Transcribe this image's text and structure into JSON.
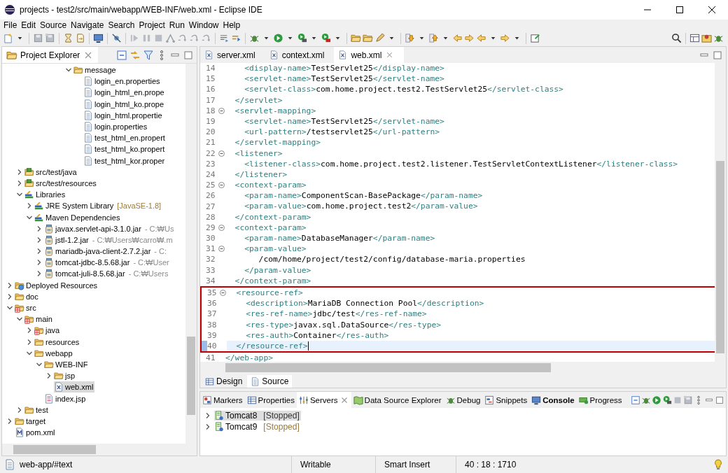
{
  "window": {
    "title": "projects - test2/src/main/webapp/WEB-INF/web.xml - Eclipse IDE"
  },
  "menu": [
    "File",
    "Edit",
    "Source",
    "Navigate",
    "Search",
    "Project",
    "Run",
    "Window",
    "Help"
  ],
  "project_explorer": {
    "title": "Project Explorer",
    "cut_branches": [
      [
        {
          "label": "message",
          "kind": "folder",
          "expanded": true,
          "selected": false,
          "children": [
            {
              "label": "login_en.properties",
              "kind": "file",
              "selected": false
            },
            {
              "label": "login_html_en.prope",
              "kind": "file",
              "selected": false
            },
            {
              "label": "login_html_ko.prope",
              "kind": "file",
              "selected": false
            },
            {
              "label": "login_html.propertie",
              "kind": "file",
              "selected": false
            },
            {
              "label": "login.properties",
              "kind": "file",
              "selected": false
            },
            {
              "label": "test_html_en.propert",
              "kind": "file",
              "selected": false
            },
            {
              "label": "test_html_ko.propert",
              "kind": "file",
              "selected": false
            },
            {
              "label": "test_html_kor.proper",
              "kind": "file",
              "selected": false
            }
          ]
        }
      ],
      [
        {
          "label": "src/test/java",
          "kind": "package",
          "expanded": false,
          "selected": false
        },
        {
          "label": "src/test/resources",
          "kind": "package",
          "expanded": false,
          "selected": false
        },
        {
          "label": "Libraries",
          "kind": "library",
          "expanded": true,
          "selected": false,
          "children": [
            {
              "label": "JRE System Library",
              "detail": "[JavaSE-1.8]",
              "kind": "library",
              "expanded": false,
              "selected": false
            },
            {
              "label": "Maven Dependencies",
              "kind": "library",
              "expanded": true,
              "selected": false,
              "children": [
                {
                  "label": "javax.servlet-api-3.1.0.jar",
                  "detail": "- C:₩Us",
                  "kind": "jar",
                  "expanded": false,
                  "selected": false
                },
                {
                  "label": "jstl-1.2.jar",
                  "detail": "- C:₩Users₩carro₩.m",
                  "kind": "jar",
                  "expanded": false,
                  "selected": false
                },
                {
                  "label": "mariadb-java-client-2.7.2.jar",
                  "detail": "- C:",
                  "kind": "jar",
                  "expanded": false,
                  "selected": false
                },
                {
                  "label": "tomcat-jdbc-8.5.68.jar",
                  "detail": "- C:₩User",
                  "kind": "jar",
                  "expanded": false,
                  "selected": false
                },
                {
                  "label": "tomcat-juli-8.5.68.jar",
                  "detail": "- C:₩Users",
                  "kind": "jar",
                  "expanded": false,
                  "selected": false
                }
              ]
            }
          ]
        }
      ]
    ],
    "items": [
      {
        "label": "Deployed Resources",
        "kind": "web",
        "expanded": false,
        "selected": false
      },
      {
        "label": "doc",
        "kind": "folder",
        "expanded": false,
        "selected": false
      },
      {
        "label": "src",
        "kind": "source",
        "expanded": true,
        "selected": false,
        "children": [
          {
            "label": "main",
            "kind": "source",
            "expanded": true,
            "selected": false,
            "children": [
              {
                "label": "java",
                "kind": "source",
                "expanded": false,
                "selected": false
              },
              {
                "label": "resources",
                "kind": "folder",
                "expanded": false,
                "selected": false
              },
              {
                "label": "webapp",
                "kind": "folder",
                "expanded": true,
                "selected": false,
                "children": [
                  {
                    "label": "WEB-INF",
                    "kind": "folder",
                    "expanded": true,
                    "selected": false,
                    "children": [
                      {
                        "label": "jsp",
                        "kind": "folder",
                        "expanded": false,
                        "selected": false
                      },
                      {
                        "label": "web.xml",
                        "kind": "xml",
                        "selected": true
                      }
                    ]
                  },
                  {
                    "label": "index.jsp",
                    "kind": "jsp",
                    "selected": false
                  }
                ]
              }
            ]
          },
          {
            "label": "test",
            "kind": "folder",
            "expanded": false,
            "selected": false
          }
        ]
      },
      {
        "label": "target",
        "kind": "folder",
        "expanded": false,
        "selected": false
      },
      {
        "label": "pom.xml",
        "kind": "maven",
        "selected": false
      }
    ]
  },
  "editor": {
    "tabs": [
      {
        "label": "server.xml",
        "selected": false
      },
      {
        "label": "context.xml",
        "selected": false
      },
      {
        "label": "web.xml",
        "selected": true
      }
    ],
    "lines": [
      {
        "number": "14",
        "fold": false,
        "boxed": false,
        "current": false,
        "tokens": [
          {
            "kind": "tag",
            "text": "    <display-name>"
          },
          {
            "kind": "text",
            "text": "TestServlet25"
          },
          {
            "kind": "tag",
            "text": "</display-name>"
          }
        ]
      },
      {
        "number": "15",
        "fold": false,
        "boxed": false,
        "current": false,
        "tokens": [
          {
            "kind": "tag",
            "text": "    <servlet-name>"
          },
          {
            "kind": "text",
            "text": "TestServlet25"
          },
          {
            "kind": "tag",
            "text": "</servlet-name>"
          }
        ]
      },
      {
        "number": "16",
        "fold": false,
        "boxed": false,
        "current": false,
        "tokens": [
          {
            "kind": "tag",
            "text": "    <servlet-class>"
          },
          {
            "kind": "text",
            "text": "com.home.project.test2.TestServlet25"
          },
          {
            "kind": "tag",
            "text": "</servlet-class>"
          }
        ]
      },
      {
        "number": "17",
        "fold": false,
        "boxed": false,
        "current": false,
        "tokens": [
          {
            "kind": "tag",
            "text": "  </servlet>"
          }
        ]
      },
      {
        "number": "18",
        "fold": true,
        "boxed": false,
        "current": false,
        "tokens": [
          {
            "kind": "tag",
            "text": "  <servlet-mapping>"
          }
        ]
      },
      {
        "number": "19",
        "fold": false,
        "boxed": false,
        "current": false,
        "tokens": [
          {
            "kind": "tag",
            "text": "    <servlet-name>"
          },
          {
            "kind": "text",
            "text": "TestServlet25"
          },
          {
            "kind": "tag",
            "text": "</servlet-name>"
          }
        ]
      },
      {
        "number": "20",
        "fold": false,
        "boxed": false,
        "current": false,
        "tokens": [
          {
            "kind": "tag",
            "text": "    <url-pattern>"
          },
          {
            "kind": "text",
            "text": "/testservlet25"
          },
          {
            "kind": "tag",
            "text": "</url-pattern>"
          }
        ]
      },
      {
        "number": "21",
        "fold": false,
        "boxed": false,
        "current": false,
        "tokens": [
          {
            "kind": "tag",
            "text": "  </servlet-mapping>"
          }
        ]
      },
      {
        "number": "22",
        "fold": true,
        "boxed": false,
        "current": false,
        "tokens": [
          {
            "kind": "tag",
            "text": "  <listener>"
          }
        ]
      },
      {
        "number": "23",
        "fold": false,
        "boxed": false,
        "current": false,
        "tokens": [
          {
            "kind": "tag",
            "text": "    <listener-class>"
          },
          {
            "kind": "text",
            "text": "com.home.project.test2.listener.TestServletContextListener"
          },
          {
            "kind": "tag",
            "text": "</listener-class>"
          }
        ]
      },
      {
        "number": "24",
        "fold": false,
        "boxed": false,
        "current": false,
        "tokens": [
          {
            "kind": "tag",
            "text": "  </listener>"
          }
        ]
      },
      {
        "number": "25",
        "fold": true,
        "boxed": false,
        "current": false,
        "tokens": [
          {
            "kind": "tag",
            "text": "  <context-param>"
          }
        ]
      },
      {
        "number": "26",
        "fold": false,
        "boxed": false,
        "current": false,
        "tokens": [
          {
            "kind": "tag",
            "text": "    <param-name>"
          },
          {
            "kind": "text",
            "text": "ComponentScan-BasePackage"
          },
          {
            "kind": "tag",
            "text": "</param-name>"
          }
        ]
      },
      {
        "number": "27",
        "fold": false,
        "boxed": false,
        "current": false,
        "tokens": [
          {
            "kind": "tag",
            "text": "    <param-value>"
          },
          {
            "kind": "text",
            "text": "com.home.project.test2"
          },
          {
            "kind": "tag",
            "text": "</param-value>"
          }
        ]
      },
      {
        "number": "28",
        "fold": false,
        "boxed": false,
        "current": false,
        "tokens": [
          {
            "kind": "tag",
            "text": "  </context-param>"
          }
        ]
      },
      {
        "number": "29",
        "fold": true,
        "boxed": false,
        "current": false,
        "tokens": [
          {
            "kind": "tag",
            "text": "  <context-param>"
          }
        ]
      },
      {
        "number": "30",
        "fold": false,
        "boxed": false,
        "current": false,
        "tokens": [
          {
            "kind": "tag",
            "text": "    <param-name>"
          },
          {
            "kind": "text",
            "text": "DatabaseManager"
          },
          {
            "kind": "tag",
            "text": "</param-name>"
          }
        ]
      },
      {
        "number": "31",
        "fold": true,
        "boxed": false,
        "current": false,
        "tokens": [
          {
            "kind": "tag",
            "text": "    <param-value>"
          }
        ]
      },
      {
        "number": "32",
        "fold": false,
        "boxed": false,
        "current": false,
        "tokens": [
          {
            "kind": "text",
            "text": "       /com/home/project/test2/config/database-maria.properties"
          }
        ]
      },
      {
        "number": "33",
        "fold": false,
        "boxed": false,
        "current": false,
        "tokens": [
          {
            "kind": "tag",
            "text": "    </param-value>"
          }
        ]
      },
      {
        "number": "34",
        "fold": false,
        "boxed": false,
        "current": false,
        "tokens": [
          {
            "kind": "tag",
            "text": "  </context-param>"
          }
        ]
      },
      {
        "number": "35",
        "fold": true,
        "boxed": true,
        "current": false,
        "tokens": [
          {
            "kind": "tag",
            "text": "  <resource-ref>"
          }
        ]
      },
      {
        "number": "36",
        "fold": false,
        "boxed": true,
        "current": false,
        "tokens": [
          {
            "kind": "tag",
            "text": "    <description>"
          },
          {
            "kind": "text",
            "text": "MariaDB Connection Pool"
          },
          {
            "kind": "tag",
            "text": "</description>"
          }
        ]
      },
      {
        "number": "37",
        "fold": false,
        "boxed": true,
        "current": false,
        "tokens": [
          {
            "kind": "tag",
            "text": "    <res-ref-name>"
          },
          {
            "kind": "text",
            "text": "jdbc/test"
          },
          {
            "kind": "tag",
            "text": "</res-ref-name>"
          }
        ]
      },
      {
        "number": "38",
        "fold": false,
        "boxed": true,
        "current": false,
        "tokens": [
          {
            "kind": "tag",
            "text": "    <res-type>"
          },
          {
            "kind": "text",
            "text": "javax.sql.DataSource"
          },
          {
            "kind": "tag",
            "text": "</res-type>"
          }
        ]
      },
      {
        "number": "39",
        "fold": false,
        "boxed": true,
        "current": false,
        "tokens": [
          {
            "kind": "tag",
            "text": "    <res-auth>"
          },
          {
            "kind": "text",
            "text": "Container"
          },
          {
            "kind": "tag",
            "text": "</res-auth>"
          }
        ]
      },
      {
        "number": "40",
        "fold": false,
        "boxed": true,
        "current": true,
        "tokens": [
          {
            "kind": "tag",
            "text": "  </resource-ref>"
          }
        ]
      },
      {
        "number": "41",
        "fold": false,
        "boxed": false,
        "current": false,
        "tokens": [
          {
            "kind": "tag",
            "text": "</web-app>"
          }
        ]
      }
    ],
    "view_tabs": [
      {
        "label": "Design",
        "selected": false
      },
      {
        "label": "Source",
        "selected": true
      }
    ]
  },
  "bottom_panel": {
    "tabs": [
      {
        "label": "Markers",
        "selected": false,
        "emphasized": false
      },
      {
        "label": "Properties",
        "selected": false,
        "emphasized": false
      },
      {
        "label": "Servers",
        "selected": true,
        "emphasized": false
      },
      {
        "label": "Data Source Explorer",
        "selected": false,
        "emphasized": false
      },
      {
        "label": "Debug",
        "selected": false,
        "emphasized": false
      },
      {
        "label": "Snippets",
        "selected": false,
        "emphasized": false
      },
      {
        "label": "Console",
        "selected": false,
        "emphasized": true
      },
      {
        "label": "Progress",
        "selected": false,
        "emphasized": false
      }
    ],
    "servers": [
      {
        "name": "Tomcat8",
        "status": "[Stopped]",
        "expanded": false,
        "selected": true
      },
      {
        "name": "Tomcat9",
        "status": "[Stopped]",
        "expanded": false,
        "selected": false
      }
    ]
  },
  "status_bar": {
    "path": "web-app/#text",
    "mode": "Writable",
    "insert_mode": "Smart Insert",
    "position": "40 : 18 : 1710"
  }
}
